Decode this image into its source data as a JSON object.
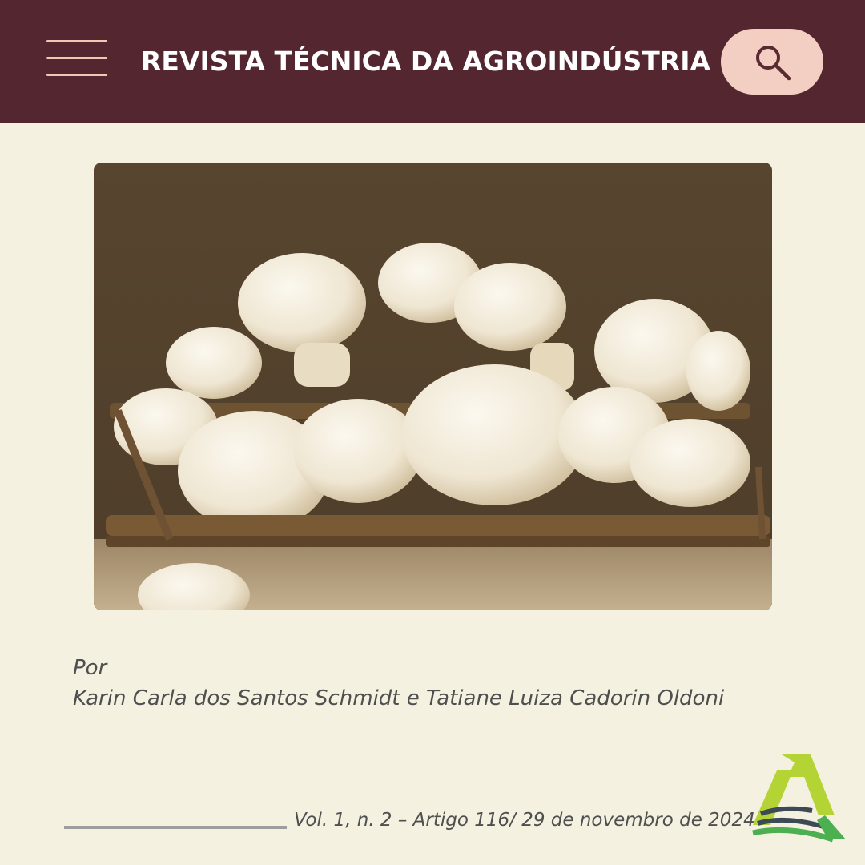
{
  "header": {
    "title": "REVISTA TÉCNICA DA AGROINDÚSTRIA",
    "menu_icon": "hamburger-menu-icon",
    "search_icon": "magnifier-icon"
  },
  "colors": {
    "header_background": "#532630",
    "page_background": "#f5f1e1",
    "menu_lines": "#f0c8b4",
    "search_button": "#f3cfc3",
    "body_text": "#4f4f4f",
    "logo_green_light": "#b4d335",
    "logo_green": "#4caf50",
    "logo_slate": "#3d4a56"
  },
  "article": {
    "image_subject": "mushrooms-in-basket",
    "byline_prefix": "Por",
    "authors": "Karin Carla dos Santos Schmidt e Tatiane Luiza Cadorin Oldoni"
  },
  "footer": {
    "issue_info": "Vol. 1, n. 2 – Artigo 116/ 29 de novembro de 2024",
    "logo_icon": "agroindustry-a-logo-icon"
  }
}
